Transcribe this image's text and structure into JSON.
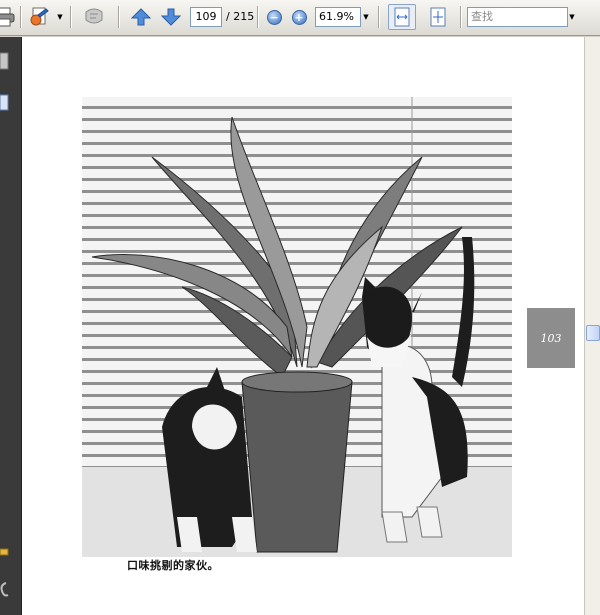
{
  "toolbar": {
    "page_number": "109",
    "page_total": "/ 215",
    "zoom_value": "61.9%",
    "search_placeholder": "查找",
    "icons": [
      "print-icon",
      "sign-icon",
      "dropdown-icon",
      "hand-icon",
      "prev-page-icon",
      "next-page-icon",
      "zoom-out-icon",
      "zoom-in-icon",
      "fit-width-icon",
      "fit-page-icon"
    ]
  },
  "document": {
    "caption": "口味挑剔的家伙。",
    "page_tab": "103"
  },
  "colors": {
    "toolbar_bg": "#dcdad3",
    "nav_bg": "#3a3a3a",
    "page_tab_bg": "#8d8d8d",
    "accent": "#5d8ed1"
  }
}
